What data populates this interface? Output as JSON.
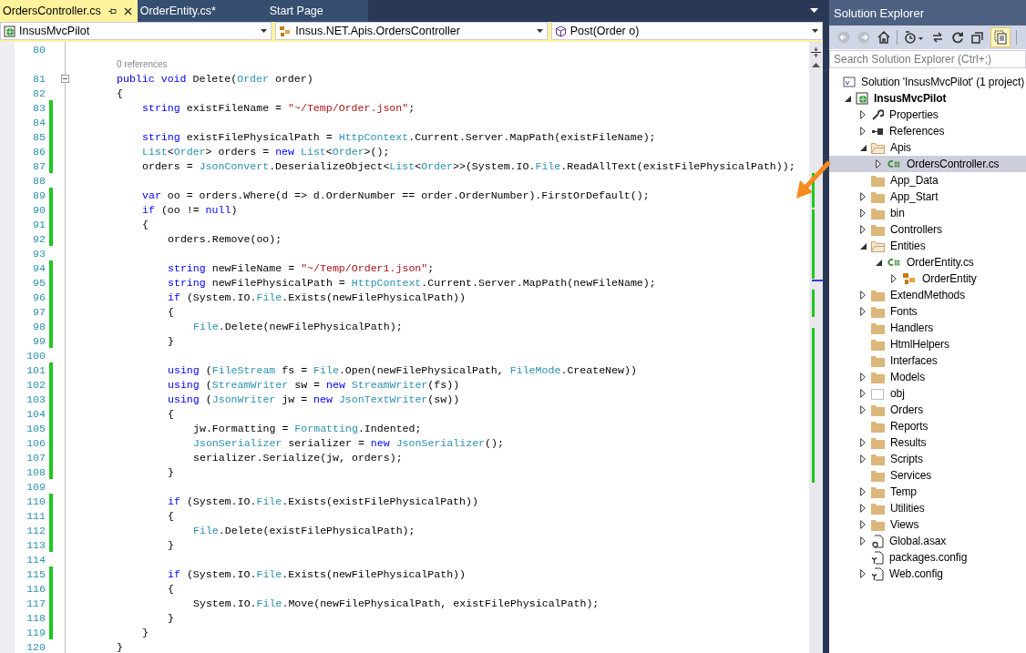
{
  "tabs": [
    {
      "label": "OrdersController.cs",
      "selected": true,
      "pinned": true
    },
    {
      "label": "OrderEntity.cs*",
      "selected": false,
      "pinned": false
    },
    {
      "label": "Start Page",
      "selected": false,
      "pinned": false
    }
  ],
  "navigation_bar": [
    {
      "kind": "project",
      "text": "InsusMvcPilot"
    },
    {
      "kind": "type",
      "text": "Insus.NET.Apis.OrdersController"
    },
    {
      "kind": "member",
      "text": "Post(Order o)"
    }
  ],
  "editor": {
    "lines": [
      {
        "number": "80",
        "changed": false
      },
      {
        "number": "81",
        "changed": false,
        "codelens": "0 references",
        "tokens": [
          {
            "t": "        public void",
            "kind": "kw"
          },
          {
            "t": " Delete(",
            "kind": "plain"
          },
          {
            "t": "Order",
            "kind": "type"
          },
          {
            "t": " order)",
            "kind": "plain"
          }
        ]
      },
      {
        "number": "82",
        "changed": false,
        "tokens": [
          {
            "t": "        {",
            "kind": "plain"
          }
        ]
      },
      {
        "number": "83",
        "changed": true,
        "tokens": [
          {
            "t": "            string",
            "kind": "kw"
          },
          {
            "t": " existFileName = ",
            "kind": "plain"
          },
          {
            "t": "\"~/Temp/Order.json\"",
            "kind": "str"
          },
          {
            "t": ";",
            "kind": "plain"
          }
        ]
      },
      {
        "number": "84",
        "changed": true
      },
      {
        "number": "85",
        "changed": true,
        "tokens": [
          {
            "t": "            string",
            "kind": "kw"
          },
          {
            "t": " existFilePhysicalPath = ",
            "kind": "plain"
          },
          {
            "t": "HttpContext",
            "kind": "type"
          },
          {
            "t": ".Current.Server.MapPath(existFileName);",
            "kind": "plain"
          }
        ]
      },
      {
        "number": "86",
        "changed": true,
        "tokens": [
          {
            "t": "            List",
            "kind": "type"
          },
          {
            "t": "<",
            "kind": "plain"
          },
          {
            "t": "Order",
            "kind": "type"
          },
          {
            "t": "> orders = ",
            "kind": "plain"
          },
          {
            "t": "new ",
            "kind": "kw"
          },
          {
            "t": "List",
            "kind": "type"
          },
          {
            "t": "<",
            "kind": "plain"
          },
          {
            "t": "Order",
            "kind": "type"
          },
          {
            "t": ">();",
            "kind": "plain"
          }
        ]
      },
      {
        "number": "87",
        "changed": true,
        "tokens": [
          {
            "t": "            orders = ",
            "kind": "plain"
          },
          {
            "t": "JsonConvert",
            "kind": "type"
          },
          {
            "t": ".DeserializeObject<",
            "kind": "plain"
          },
          {
            "t": "List",
            "kind": "type"
          },
          {
            "t": "<",
            "kind": "plain"
          },
          {
            "t": "Order",
            "kind": "type"
          },
          {
            "t": ">>(System.IO.",
            "kind": "plain"
          },
          {
            "t": "File",
            "kind": "type"
          },
          {
            "t": ".ReadAllText(existFilePhysicalPath));",
            "kind": "plain"
          }
        ]
      },
      {
        "number": "88",
        "changed": false
      },
      {
        "number": "89",
        "changed": true,
        "tokens": [
          {
            "t": "            var",
            "kind": "kw"
          },
          {
            "t": " oo = orders.Where(d => d.OrderNumber == order.OrderNumber).FirstOrDefault();",
            "kind": "plain"
          }
        ]
      },
      {
        "number": "90",
        "changed": true,
        "tokens": [
          {
            "t": "            if",
            "kind": "kw"
          },
          {
            "t": " (oo != ",
            "kind": "plain"
          },
          {
            "t": "null",
            "kind": "kw"
          },
          {
            "t": ")",
            "kind": "plain"
          }
        ]
      },
      {
        "number": "91",
        "changed": true,
        "tokens": [
          {
            "t": "            {",
            "kind": "plain"
          }
        ]
      },
      {
        "number": "92",
        "changed": true,
        "tokens": [
          {
            "t": "                orders.Remove(oo);",
            "kind": "plain"
          }
        ]
      },
      {
        "number": "93",
        "changed": false
      },
      {
        "number": "94",
        "changed": true,
        "tokens": [
          {
            "t": "                string",
            "kind": "kw"
          },
          {
            "t": " newFileName = ",
            "kind": "plain"
          },
          {
            "t": "\"~/Temp/Order1.json\"",
            "kind": "str"
          },
          {
            "t": ";",
            "kind": "plain"
          }
        ]
      },
      {
        "number": "95",
        "changed": true,
        "tokens": [
          {
            "t": "                string",
            "kind": "kw"
          },
          {
            "t": " newFilePhysicalPath = ",
            "kind": "plain"
          },
          {
            "t": "HttpContext",
            "kind": "type"
          },
          {
            "t": ".Current.Server.MapPath(newFileName);",
            "kind": "plain"
          }
        ]
      },
      {
        "number": "96",
        "changed": true,
        "tokens": [
          {
            "t": "                if",
            "kind": "kw"
          },
          {
            "t": " (System.IO.",
            "kind": "plain"
          },
          {
            "t": "File",
            "kind": "type"
          },
          {
            "t": ".Exists(newFilePhysicalPath))",
            "kind": "plain"
          }
        ]
      },
      {
        "number": "97",
        "changed": true,
        "tokens": [
          {
            "t": "                {",
            "kind": "plain"
          }
        ]
      },
      {
        "number": "98",
        "changed": true,
        "tokens": [
          {
            "t": "                    File",
            "kind": "type"
          },
          {
            "t": ".Delete(newFilePhysicalPath);",
            "kind": "plain"
          }
        ]
      },
      {
        "number": "99",
        "changed": true,
        "tokens": [
          {
            "t": "                }",
            "kind": "plain"
          }
        ]
      },
      {
        "number": "100",
        "changed": false
      },
      {
        "number": "101",
        "changed": true,
        "tokens": [
          {
            "t": "                using",
            "kind": "kw"
          },
          {
            "t": " (",
            "kind": "plain"
          },
          {
            "t": "FileStream",
            "kind": "type"
          },
          {
            "t": " fs = ",
            "kind": "plain"
          },
          {
            "t": "File",
            "kind": "type"
          },
          {
            "t": ".Open(newFilePhysicalPath, ",
            "kind": "plain"
          },
          {
            "t": "FileMode",
            "kind": "type"
          },
          {
            "t": ".CreateNew))",
            "kind": "plain"
          }
        ]
      },
      {
        "number": "102",
        "changed": true,
        "tokens": [
          {
            "t": "                using",
            "kind": "kw"
          },
          {
            "t": " (",
            "kind": "plain"
          },
          {
            "t": "StreamWriter",
            "kind": "type"
          },
          {
            "t": " sw = ",
            "kind": "plain"
          },
          {
            "t": "new ",
            "kind": "kw"
          },
          {
            "t": "StreamWriter",
            "kind": "type"
          },
          {
            "t": "(fs))",
            "kind": "plain"
          }
        ]
      },
      {
        "number": "103",
        "changed": true,
        "tokens": [
          {
            "t": "                using",
            "kind": "kw"
          },
          {
            "t": " (",
            "kind": "plain"
          },
          {
            "t": "JsonWriter",
            "kind": "type"
          },
          {
            "t": " jw = ",
            "kind": "plain"
          },
          {
            "t": "new ",
            "kind": "kw"
          },
          {
            "t": "JsonTextWriter",
            "kind": "type"
          },
          {
            "t": "(sw))",
            "kind": "plain"
          }
        ]
      },
      {
        "number": "104",
        "changed": true,
        "tokens": [
          {
            "t": "                {",
            "kind": "plain"
          }
        ]
      },
      {
        "number": "105",
        "changed": true,
        "tokens": [
          {
            "t": "                    jw.Formatting = ",
            "kind": "plain"
          },
          {
            "t": "Formatting",
            "kind": "type"
          },
          {
            "t": ".Indented;",
            "kind": "plain"
          }
        ]
      },
      {
        "number": "106",
        "changed": true,
        "tokens": [
          {
            "t": "                    JsonSerializer",
            "kind": "type"
          },
          {
            "t": " serializer = ",
            "kind": "plain"
          },
          {
            "t": "new ",
            "kind": "kw"
          },
          {
            "t": "JsonSerializer",
            "kind": "type"
          },
          {
            "t": "();",
            "kind": "plain"
          }
        ]
      },
      {
        "number": "107",
        "changed": true,
        "tokens": [
          {
            "t": "                    serializer.Serialize(jw, orders);",
            "kind": "plain"
          }
        ]
      },
      {
        "number": "108",
        "changed": true,
        "tokens": [
          {
            "t": "                }",
            "kind": "plain"
          }
        ]
      },
      {
        "number": "109",
        "changed": false
      },
      {
        "number": "110",
        "changed": true,
        "tokens": [
          {
            "t": "                if",
            "kind": "kw"
          },
          {
            "t": " (System.IO.",
            "kind": "plain"
          },
          {
            "t": "File",
            "kind": "type"
          },
          {
            "t": ".Exists(existFilePhysicalPath))",
            "kind": "plain"
          }
        ]
      },
      {
        "number": "111",
        "changed": true,
        "tokens": [
          {
            "t": "                {",
            "kind": "plain"
          }
        ]
      },
      {
        "number": "112",
        "changed": true,
        "tokens": [
          {
            "t": "                    File",
            "kind": "type"
          },
          {
            "t": ".Delete(existFilePhysicalPath);",
            "kind": "plain"
          }
        ]
      },
      {
        "number": "113",
        "changed": true,
        "tokens": [
          {
            "t": "                }",
            "kind": "plain"
          }
        ]
      },
      {
        "number": "114",
        "changed": false
      },
      {
        "number": "115",
        "changed": true,
        "tokens": [
          {
            "t": "                if",
            "kind": "kw"
          },
          {
            "t": " (System.IO.",
            "kind": "plain"
          },
          {
            "t": "File",
            "kind": "type"
          },
          {
            "t": ".Exists(newFilePhysicalPath))",
            "kind": "plain"
          }
        ]
      },
      {
        "number": "116",
        "changed": true,
        "tokens": [
          {
            "t": "                {",
            "kind": "plain"
          }
        ]
      },
      {
        "number": "117",
        "changed": true,
        "tokens": [
          {
            "t": "                    System.IO.",
            "kind": "plain"
          },
          {
            "t": "File",
            "kind": "type"
          },
          {
            "t": ".Move(newFilePhysicalPath, existFilePhysicalPath);",
            "kind": "plain"
          }
        ]
      },
      {
        "number": "118",
        "changed": true,
        "tokens": [
          {
            "t": "                }",
            "kind": "plain"
          }
        ]
      },
      {
        "number": "119",
        "changed": true,
        "tokens": [
          {
            "t": "            }",
            "kind": "plain"
          }
        ]
      },
      {
        "number": "120",
        "changed": false,
        "tokens": [
          {
            "t": "        }",
            "kind": "plain"
          }
        ]
      }
    ]
  },
  "solution_explorer": {
    "title": "Solution Explorer",
    "search": {
      "placeholder": "Search Solution Explorer (Ctrl+;)"
    },
    "tree": [
      {
        "label": "Solution 'InsusMvcPilot' (1 project)",
        "kind": "solution",
        "expandable": false,
        "expanded": false,
        "selected": false,
        "children": [
          {
            "label": "InsusMvcPilot",
            "kind": "project",
            "expandable": true,
            "expanded": true,
            "selected": false,
            "children": [
              {
                "label": "Properties",
                "kind": "properties",
                "expandable": true,
                "expanded": false,
                "selected": false
              },
              {
                "label": "References",
                "kind": "references",
                "expandable": true,
                "expanded": false,
                "selected": false
              },
              {
                "label": "Apis",
                "kind": "open-folder",
                "expandable": true,
                "expanded": true,
                "selected": false,
                "children": [
                  {
                    "label": "OrdersController.cs",
                    "kind": "csharp-file",
                    "expandable": true,
                    "expanded": false,
                    "selected": true
                  }
                ]
              },
              {
                "label": "App_Data",
                "kind": "folder",
                "expandable": false,
                "expanded": false,
                "selected": false
              },
              {
                "label": "App_Start",
                "kind": "folder",
                "expandable": true,
                "expanded": false,
                "selected": false
              },
              {
                "label": "bin",
                "kind": "folder",
                "expandable": true,
                "expanded": false,
                "selected": false
              },
              {
                "label": "Controllers",
                "kind": "folder",
                "expandable": true,
                "expanded": false,
                "selected": false
              },
              {
                "label": "Entities",
                "kind": "open-folder",
                "expandable": true,
                "expanded": true,
                "selected": false,
                "children": [
                  {
                    "label": "OrderEntity.cs",
                    "kind": "csharp-file",
                    "expandable": true,
                    "expanded": true,
                    "selected": false,
                    "children": [
                      {
                        "label": "OrderEntity",
                        "kind": "class",
                        "expandable": true,
                        "expanded": false,
                        "selected": false
                      }
                    ]
                  }
                ]
              },
              {
                "label": "ExtendMethods",
                "kind": "folder",
                "expandable": true,
                "expanded": false,
                "selected": false
              },
              {
                "label": "Fonts",
                "kind": "folder",
                "expandable": true,
                "expanded": false,
                "selected": false
              },
              {
                "label": "Handlers",
                "kind": "folder",
                "expandable": false,
                "expanded": false,
                "selected": false
              },
              {
                "label": "HtmlHelpers",
                "kind": "folder",
                "expandable": false,
                "expanded": false,
                "selected": false
              },
              {
                "label": "Interfaces",
                "kind": "folder",
                "expandable": false,
                "expanded": false,
                "selected": false
              },
              {
                "label": "Models",
                "kind": "folder",
                "expandable": true,
                "expanded": false,
                "selected": false
              },
              {
                "label": "obj",
                "kind": "hidden-folder",
                "expandable": true,
                "expanded": false,
                "selected": false
              },
              {
                "label": "Orders",
                "kind": "folder",
                "expandable": true,
                "expanded": false,
                "selected": false
              },
              {
                "label": "Reports",
                "kind": "folder",
                "expandable": false,
                "expanded": false,
                "selected": false
              },
              {
                "label": "Results",
                "kind": "folder",
                "expandable": true,
                "expanded": false,
                "selected": false
              },
              {
                "label": "Scripts",
                "kind": "folder",
                "expandable": true,
                "expanded": false,
                "selected": false
              },
              {
                "label": "Services",
                "kind": "folder",
                "expandable": false,
                "expanded": false,
                "selected": false
              },
              {
                "label": "Temp",
                "kind": "folder",
                "expandable": true,
                "expanded": false,
                "selected": false
              },
              {
                "label": "Utilities",
                "kind": "folder",
                "expandable": true,
                "expanded": false,
                "selected": false
              },
              {
                "label": "Views",
                "kind": "folder",
                "expandable": true,
                "expanded": false,
                "selected": false
              },
              {
                "label": "Global.asax",
                "kind": "asax-file",
                "expandable": true,
                "expanded": false,
                "selected": false
              },
              {
                "label": "packages.config",
                "kind": "config-file",
                "expandable": false,
                "expanded": false,
                "selected": false
              },
              {
                "label": "Web.config",
                "kind": "config-file",
                "expandable": true,
                "expanded": false,
                "selected": false
              }
            ]
          }
        ]
      }
    ]
  }
}
